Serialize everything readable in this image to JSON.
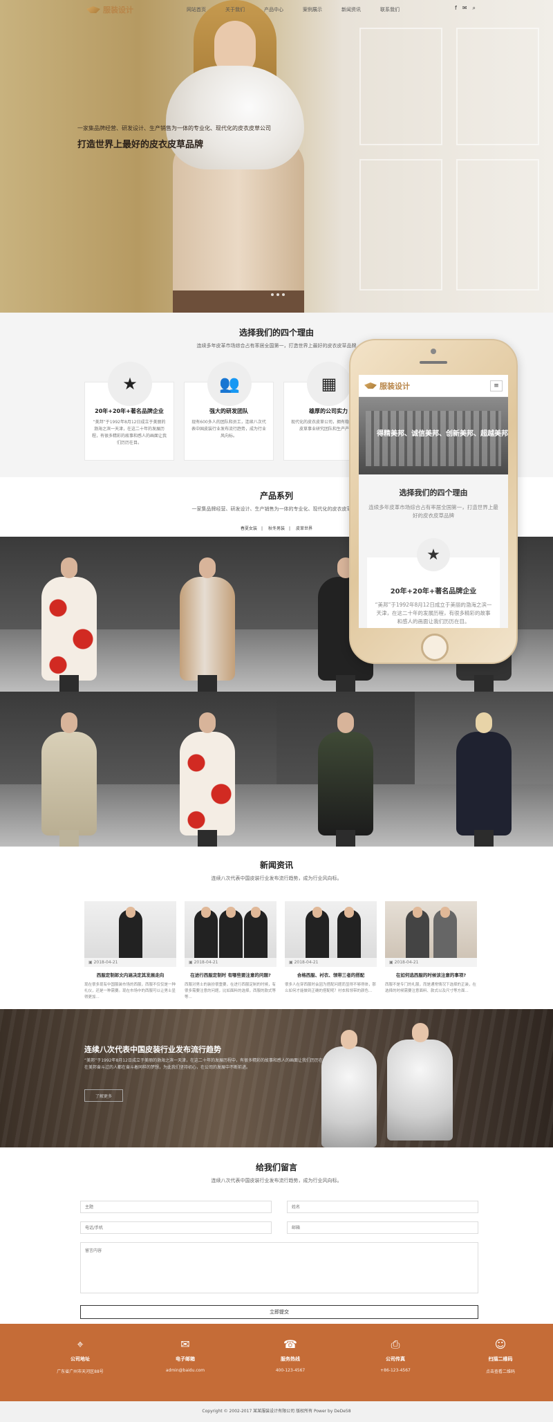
{
  "header": {
    "logo_text": "服装设计",
    "menu": [
      "网站首页",
      "关于我们",
      "产品中心",
      "案例展示",
      "新闻资讯",
      "联系我们"
    ],
    "social": [
      "f",
      "✉",
      "⌕"
    ]
  },
  "hero": {
    "subtitle": "一家集品牌经营、研发设计、生产销售为一体的专业化、现代化的皮衣皮草公司",
    "title": "打造世界上最好的皮衣皮草品牌"
  },
  "reasons": {
    "title": "选择我们的四个理由",
    "subtitle": "连续多年皮革市场综合占有率居全国第一，打造世界上最好的皮衣皮草品牌",
    "cards": [
      {
        "icon": "star-icon",
        "glyph": "★",
        "title": "20年+20年+著名品牌企业",
        "text": "“美邦”于1992年8月12日成立于美丽的渤海之滨一天津，在这二十年的发展历程，有很多精彩的故事和感人的画面让我们历历在目。"
      },
      {
        "icon": "team-icon",
        "glyph": "👥",
        "title": "强大的研发团队",
        "text": "现有600多人的团队和员工，连续八次代表中国皮装行业发布流行趋势，成为行业风向标。"
      },
      {
        "icon": "building-icon",
        "glyph": "▦",
        "title": "雄厚的公司实力",
        "text": "现代化的皮衣皮草公司，拥有稳定的皮衣皮草事业研究团队和生产产业。"
      }
    ]
  },
  "products": {
    "title": "产品系列",
    "subtitle": "一家集品牌经营、研发设计、生产销售为一体的专业化、现代化的皮衣皮草公司",
    "categories": [
      "春夏女装",
      "秋冬男装",
      "皮草世界"
    ]
  },
  "phone": {
    "logo_text": "服装设计",
    "menu_glyph": "≡",
    "banner_text": "得精美邦、诚信美邦、创新美邦、超越美邦",
    "section_title": "选择我们的四个理由",
    "section_sub": "连续多年皮革市场综合占有率居全国第一，打造世界上最好的皮衣皮草品牌",
    "card_title": "20年+20年+著名品牌企业",
    "card_text": "“美邦”于1992年8月12日成立于美丽的渤海之滨一天津，在这二十年的发展历程，有很多精彩的故事和感人的画面让我们历历在目。"
  },
  "news": {
    "title": "新闻资讯",
    "subtitle": "连续八次代表中国皮装行业发布流行趋势，成为行业风向标。",
    "items": [
      {
        "date": "2018-04-21",
        "title": "西服定制郎文内涵决定其发展走向",
        "text": "现在很多现有中国服装市场的西服，西服不仅仅是一种礼仪，还是一种需要。现在市场中的西服可以让男士显得更加..."
      },
      {
        "date": "2018-04-21",
        "title": "在进行西服定制时 有哪些要注意的问题?",
        "text": "西服对男士的装扮很重要，在进行西服定制的时候，有很多需要注意的问题，比如面料的选择，西服的款式等等..."
      },
      {
        "date": "2018-04-21",
        "title": "合格西服、衬衣、领带三者的搭配",
        "text": "很多人在穿西服时会因为搭配问题而显得不够得体，那么如何才能做到正确的搭配呢？衬衣和领带的颜色..."
      },
      {
        "date": "2018-04-21",
        "title": "在如何选西服的时候该注意的事项?",
        "text": "西服不是专门的礼服，而是通常情况下选择的正装，在选择的时候需要注意面料、款式以及尺寸等方面..."
      }
    ]
  },
  "feature": {
    "title": "连续八次代表中国皮装行业发布流行趋势",
    "text": "“美邦”于1992年8月12日成立于美丽的渤海之滨一天津，在这二十年的发展历程中，有很多精彩的故事和感人的画面让我们历历在目。每一个在美邦奋斗过的人都在奋斗着同样的梦想，为此我们坚持初心，在公司的发展中不断前进。",
    "button": "了解更多"
  },
  "message": {
    "title": "给我们留言",
    "subtitle": "连续八次代表中国皮装行业发布流行趋势，成为行业风向标。",
    "fields": {
      "subject": "主题",
      "name": "姓名",
      "phone": "电话/手机",
      "email": "邮箱",
      "content": "留言内容"
    },
    "submit": "立即提交"
  },
  "footer": {
    "items": [
      {
        "icon": "location-icon",
        "glyph": "⌖",
        "label": "公司地址",
        "value": "广东省广州市天河区88号"
      },
      {
        "icon": "mail-icon",
        "glyph": "✉",
        "label": "电子邮箱",
        "value": "admin@baidu.com"
      },
      {
        "icon": "phone-icon",
        "glyph": "☎",
        "label": "服务热线",
        "value": "400-123-4567"
      },
      {
        "icon": "printer-icon",
        "glyph": "⎙",
        "label": "公司传真",
        "value": "+86-123-4567"
      },
      {
        "icon": "wechat-icon",
        "glyph": "☺",
        "label": "扫描二维码",
        "value": "点击查看二维码"
      }
    ],
    "copyright": "Copyright © 2002-2017 某某服装设计有限公司 版权所有 Power by DeDe58"
  }
}
